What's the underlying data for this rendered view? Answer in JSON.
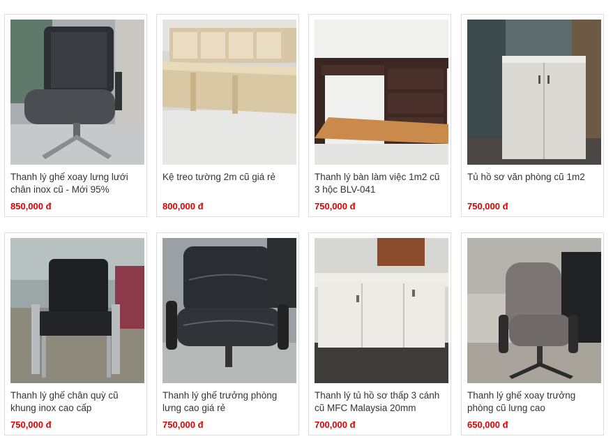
{
  "products": [
    {
      "title": "Thanh lý ghế xoay lưng lưới chân inox cũ - Mới 95%",
      "price": "850,000 đ",
      "image_icon": "mesh-office-chair-photo"
    },
    {
      "title": "Kệ treo tường 2m cũ giá rẻ",
      "price": "800,000 đ",
      "image_icon": "wall-shelf-cabinet-photo"
    },
    {
      "title": "Thanh lý bàn làm việc 1m2 cũ 3 hộc BLV-041",
      "price": "750,000 đ",
      "image_icon": "office-desk-photo"
    },
    {
      "title": "Tủ hồ sơ văn phòng cũ 1m2",
      "price": "750,000 đ",
      "image_icon": "file-cabinet-photo"
    },
    {
      "title": "Thanh lý ghế chân quỳ cũ khung inox cao cấp",
      "price": "750,000 đ",
      "image_icon": "visitor-chair-photo"
    },
    {
      "title": "Thanh lý ghế trưởng phòng lưng cao giá rẻ",
      "price": "750,000 đ",
      "image_icon": "leather-manager-chair-photo"
    },
    {
      "title": "Thanh lý tủ hồ sơ thấp 3 cánh cũ MFC Malaysia 20mm",
      "price": "700,000 đ",
      "image_icon": "low-file-cabinet-photo"
    },
    {
      "title": "Thanh lý ghế xoay trưởng phòng cũ lưng cao",
      "price": "650,000 đ",
      "image_icon": "fabric-swivel-chair-photo"
    }
  ],
  "colors": {
    "price": "#e00000",
    "title": "#333333",
    "border": "#dedede"
  }
}
